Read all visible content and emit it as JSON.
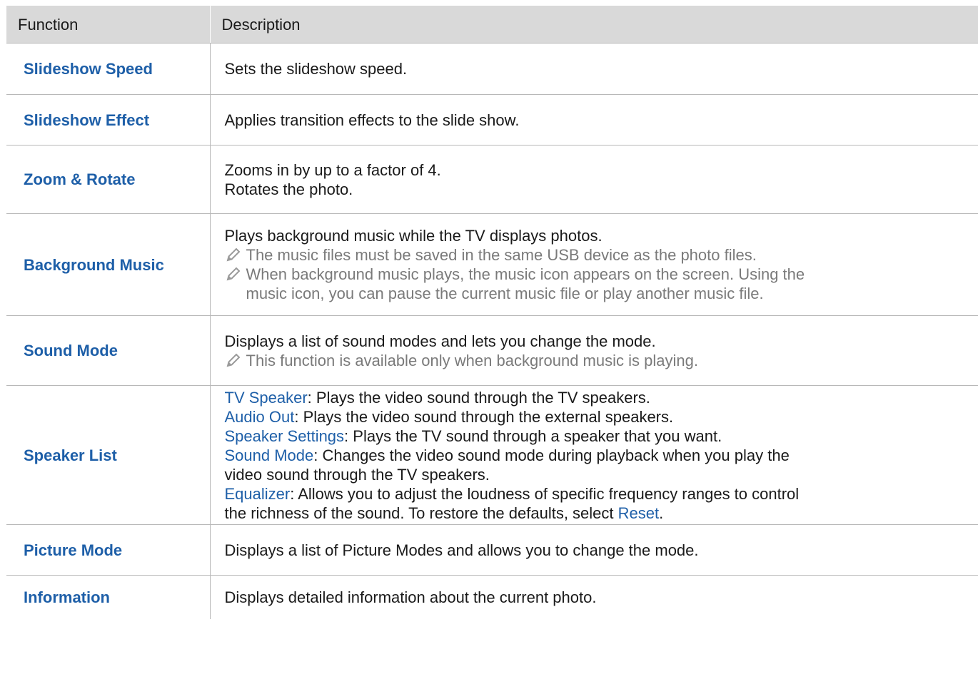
{
  "header": {
    "function": "Function",
    "description": "Description"
  },
  "rows": [
    {
      "name": "Slideshow Speed",
      "lines": [
        "Sets the slideshow speed."
      ]
    },
    {
      "name": "Slideshow Effect",
      "lines": [
        "Applies transition effects to the slide show."
      ]
    },
    {
      "name": "Zoom & Rotate",
      "lines": [
        "Zooms in by up to a factor of 4.",
        "Rotates the photo."
      ]
    },
    {
      "name": "Background Music",
      "lines": [
        "Plays background music while the TV displays photos."
      ],
      "notes": [
        [
          "The music files must be saved in the same USB device as the photo files."
        ],
        [
          "When background music plays, the music icon appears on the screen. Using the",
          "music icon, you can pause the current music file or play another music file."
        ]
      ]
    },
    {
      "name": "Sound Mode",
      "lines": [
        "Displays a list of sound modes and lets you change the mode."
      ],
      "notes": [
        [
          "This function is available only when background music is playing."
        ]
      ]
    },
    {
      "name": "Speaker List",
      "items": [
        {
          "key": "TV Speaker",
          "text": ": Plays the video sound through the TV speakers."
        },
        {
          "key": "Audio Out",
          "text": ": Plays the video sound through the external speakers."
        },
        {
          "key": "Speaker Settings",
          "text": ": Plays the TV sound through a speaker that you want."
        },
        {
          "key": "Sound Mode",
          "text": ": Changes the video sound mode during playback when you play the",
          "cont": "video sound through the TV speakers."
        },
        {
          "key": "Equalizer",
          "text": ": Allows you to adjust the loudness of specific frequency ranges to control",
          "cont": "the richness of the sound. To restore the defaults, select ",
          "reset": "Reset",
          "end": "."
        }
      ]
    },
    {
      "name": "Picture Mode",
      "lines": [
        "Displays a list of Picture Modes and allows you to change the mode."
      ]
    },
    {
      "name": "Information",
      "lines": [
        "Displays detailed information about the current photo."
      ]
    }
  ],
  "icons": {
    "note": "pencil-note-icon"
  },
  "colors": {
    "link": "#1e5fa8",
    "note": "#7a7a7a",
    "header_bg": "#d9d9d9"
  }
}
